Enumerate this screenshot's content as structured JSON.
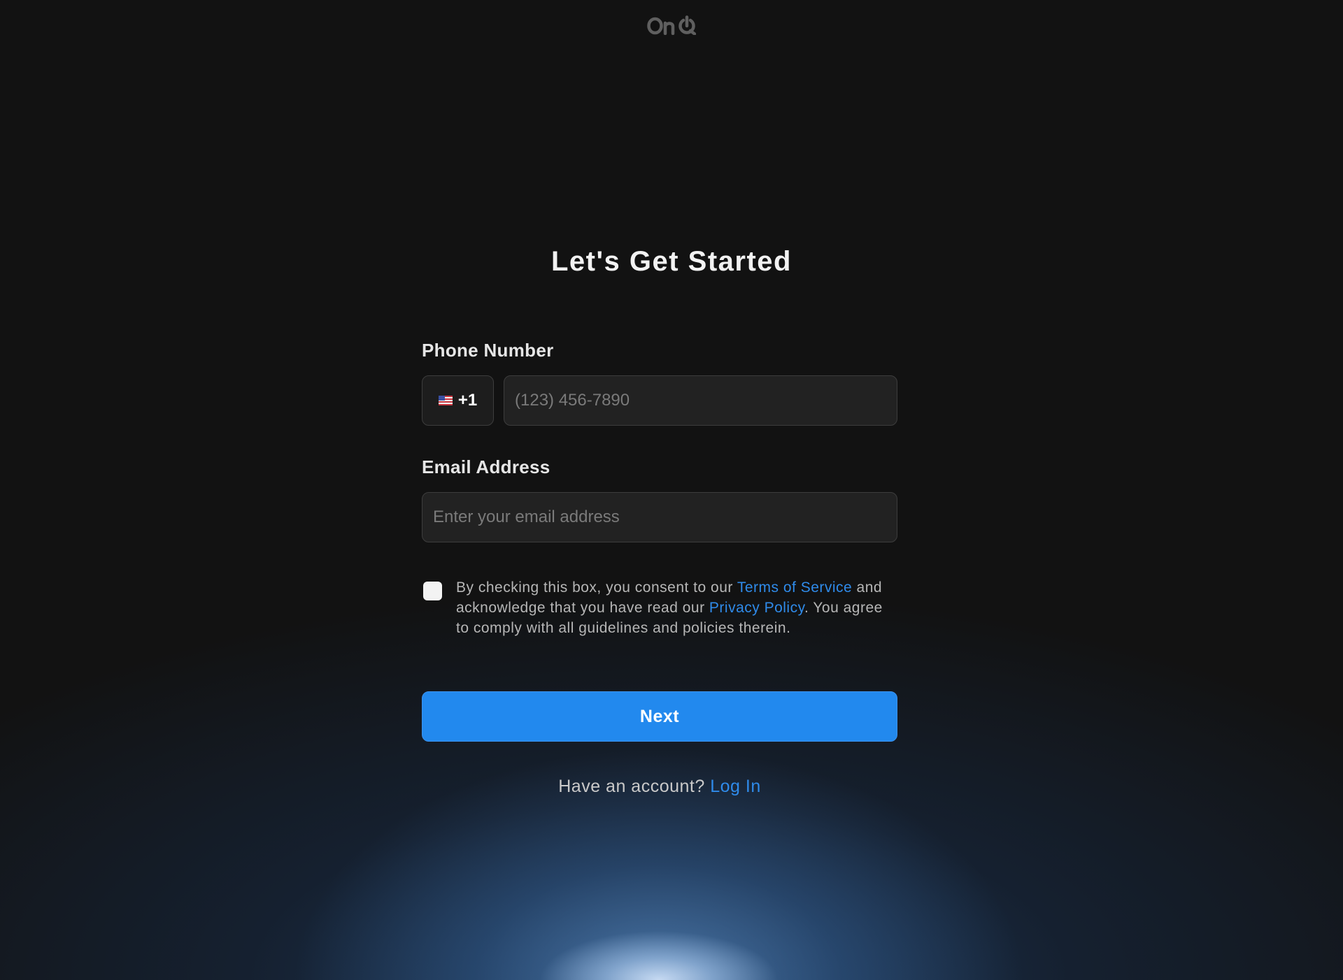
{
  "brand": {
    "logo_text": "OnQ",
    "logo_color": "#5f5f5f"
  },
  "page_title": "Let's Get Started",
  "phone": {
    "label": "Phone Number",
    "country_flag_icon": "us-flag-icon",
    "country_code": "+1",
    "value": "",
    "placeholder": "(123) 456-7890"
  },
  "email": {
    "label": "Email Address",
    "value": "",
    "placeholder": "Enter your email address"
  },
  "consent": {
    "checked": false,
    "text_before_terms": "By checking this box, you consent to our ",
    "terms_link": "Terms of Service",
    "text_between": " and acknowledge that you have read our ",
    "privacy_link": "Privacy Policy",
    "text_after": ". You agree to comply with all guidelines and policies therein."
  },
  "next_button_label": "Next",
  "login_prompt": {
    "text": "Have an account?",
    "link": "Log In"
  },
  "colors": {
    "background": "#121212",
    "accent": "#2289ee",
    "link": "#2f8bea",
    "input_background": "#222222",
    "input_border": "#3d3d3d"
  }
}
